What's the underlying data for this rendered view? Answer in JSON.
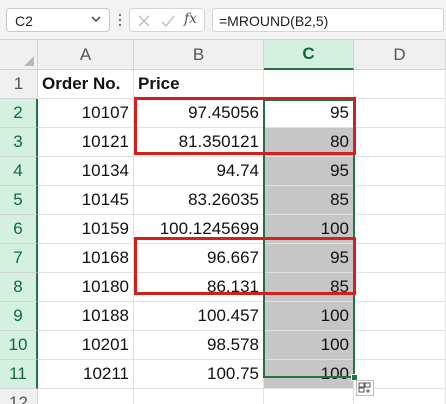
{
  "formula_bar": {
    "name_box": "C2",
    "formula": "=MROUND(B2,5)",
    "fx_label": "fx"
  },
  "grid": {
    "columns": [
      "A",
      "B",
      "C",
      "D"
    ],
    "rows": [
      "1",
      "2",
      "3",
      "4",
      "5",
      "6",
      "7",
      "8",
      "9",
      "10",
      "11",
      "12"
    ],
    "header_row": {
      "a": "Order No.",
      "b": "Price",
      "c": "",
      "d": ""
    },
    "data": [
      {
        "a": "10107",
        "b": "97.45056",
        "c": "95"
      },
      {
        "a": "10121",
        "b": "81.350121",
        "c": "80"
      },
      {
        "a": "10134",
        "b": "94.74",
        "c": "95"
      },
      {
        "a": "10145",
        "b": "83.26035",
        "c": "85"
      },
      {
        "a": "10159",
        "b": "100.1245699",
        "c": "100"
      },
      {
        "a": "10168",
        "b": "96.667",
        "c": "95"
      },
      {
        "a": "10180",
        "b": "86.131",
        "c": "85"
      },
      {
        "a": "10188",
        "b": "100.457",
        "c": "100"
      },
      {
        "a": "10201",
        "b": "98.578",
        "c": "100"
      },
      {
        "a": "10211",
        "b": "100.75",
        "c": "100"
      }
    ],
    "selected_column": "C",
    "selected_range": "C2:C11"
  },
  "colors": {
    "selection_green": "#217346",
    "highlight_red": "#d21f1f",
    "cell_shade": "#c6c6c6"
  },
  "icons": [
    "chevron-down-icon",
    "more-options-icon",
    "cancel-icon",
    "enter-icon",
    "insert-function-icon",
    "quick-analysis-icon"
  ]
}
